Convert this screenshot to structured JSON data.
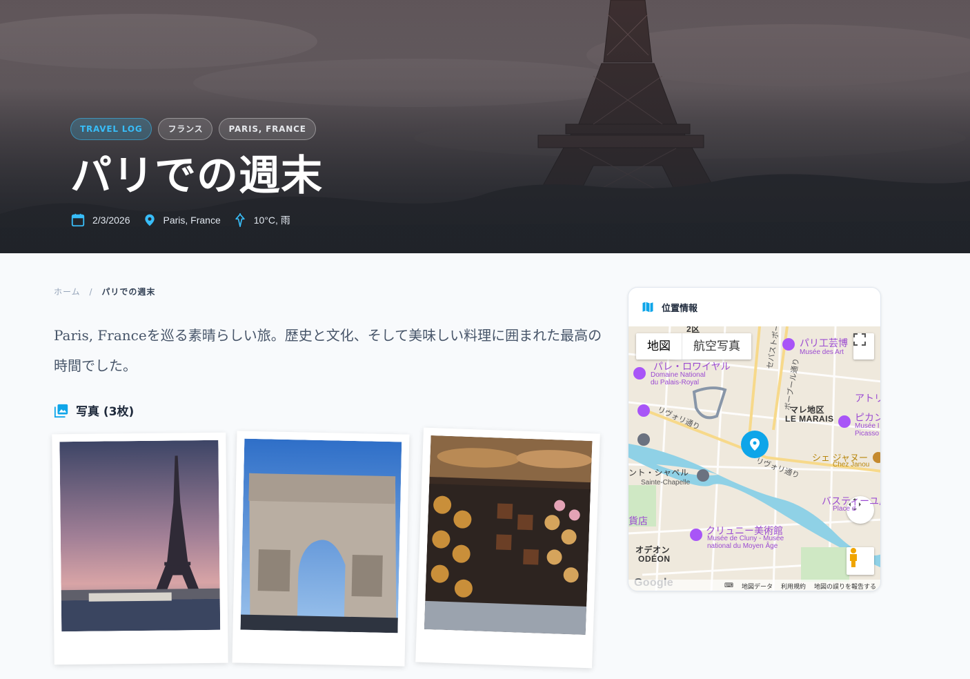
{
  "hero": {
    "tags": [
      "TRAVEL LOG",
      "フランス",
      "PARIS, FRANCE"
    ],
    "title": "パリでの週末",
    "meta": {
      "date": "2/3/2026",
      "location": "Paris, France",
      "weather": "10°C, 雨"
    },
    "icons": {
      "date": "calendar-icon",
      "location": "location-pin-icon",
      "weather": "umbrella-icon"
    }
  },
  "breadcrumb": {
    "home": "ホーム",
    "separator": "/",
    "current": "パリでの週末"
  },
  "intro": "Paris, Franceを巡る素晴らしい旅。歴史と文化、そして美味しい料理に囲まれた最高の時間でした。",
  "photos": {
    "heading": "写真 (3枚)",
    "icon": "photo-gallery-icon"
  },
  "map": {
    "heading": "位置情報",
    "type_tabs": [
      "地図",
      "航空写真"
    ],
    "labels": {
      "palais": "パレ・ロワイヤル",
      "palais_fr_1": "Domaine National",
      "palais_fr_2": "du Palais-Royal",
      "arts": "パリ工芸博",
      "arts_fr": "Musée des Art",
      "marais_jp": "マレ地区",
      "marais_fr": "LE MARAIS",
      "atelier": "アトリ",
      "picasso_jp": "ピカン",
      "picasso_fr_1": "Musée I",
      "picasso_fr_2": "Picasso",
      "chez_jp": "シェ ジャヌー",
      "chez_fr": "Chez Janou",
      "chapelle_jp": "ント・シャペル",
      "chapelle_fr": "Sainte-Chapelle",
      "bastille_jp": "バスティーユ広場",
      "bastille_fr": "Place d",
      "cluny_jp": "クリュニー美術館",
      "cluny_fr_1": "Musée de Cluny - Musée",
      "cluny_fr_2": "national du Moyen Âge",
      "odeon_jp": "オデオン",
      "odeon_fr": "ODÉON",
      "rivoli_1": "リヴォリ通り",
      "rivoli_2": "リヴォリ通り",
      "sebastopol": "セバストポール通り",
      "beaubourg": "ボーブール通り",
      "depart": "貨店",
      "district": "2区"
    },
    "footer": {
      "keyboard": "⌨",
      "data": "地図データ",
      "terms": "利用規約",
      "report": "地図の誤りを報告する"
    },
    "logo": "Google",
    "accent": "#0ea5e9"
  }
}
